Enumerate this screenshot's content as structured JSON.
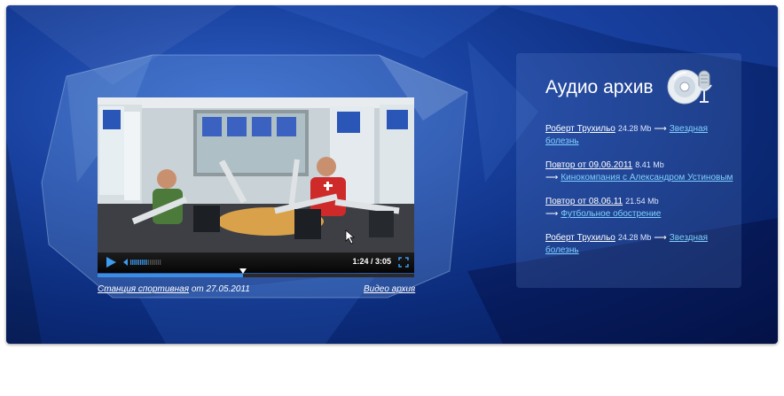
{
  "player": {
    "time": "1:24 / 3:05",
    "progress": 0.46,
    "volume": 0.55
  },
  "caption": {
    "left_link": "Станция спортивная",
    "left_date": "от 27.05.2011",
    "right_link": "Видео архив"
  },
  "audio_archive": {
    "title": "Аудио архив",
    "entries": [
      {
        "title": "Роберт Трухильо",
        "size": "24.28 Mb",
        "link": "Звездная болезнь"
      },
      {
        "title": "Повтор от 09.06.2011",
        "size": "8.41 Mb",
        "link": "Кинокомпания с Александром Устиновым"
      },
      {
        "title": "Повтор от 08.06.11",
        "size": "21.54 Mb",
        "link": "Футбольное обострение"
      },
      {
        "title": "Роберт Трухильо",
        "size": "24.28 Mb",
        "link": "Звездная болезнь"
      }
    ]
  },
  "colors": {
    "link": "#7fd0ff",
    "progress": "#3a8de0",
    "panel_bg": "#0b2a78"
  },
  "icons": [
    "play-icon",
    "volume-icon",
    "fullscreen-icon",
    "cd-microphone-icon"
  ]
}
